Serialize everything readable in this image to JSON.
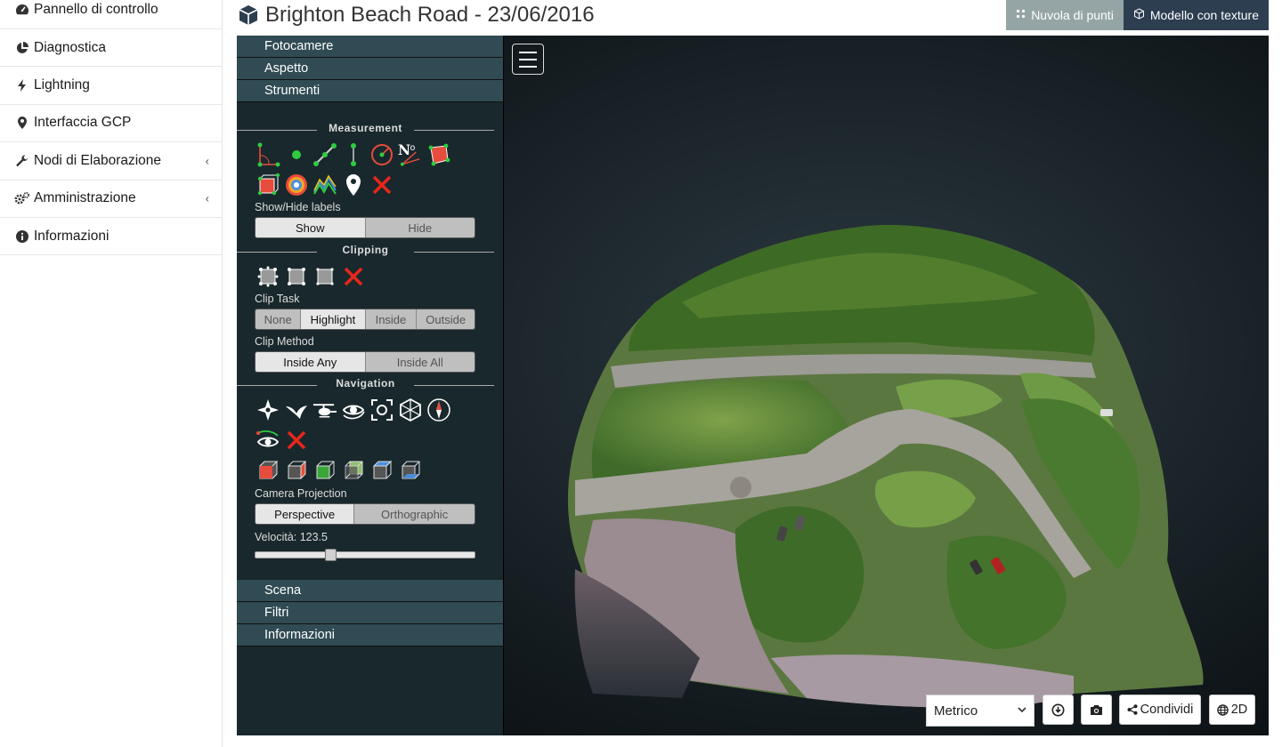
{
  "sidebar": {
    "items": [
      {
        "label": "Pannello di controllo",
        "icon": "dashboard-icon"
      },
      {
        "label": "Diagnostica",
        "icon": "pie-chart-icon"
      },
      {
        "label": "Lightning",
        "icon": "bolt-icon"
      },
      {
        "label": "Interfaccia GCP",
        "icon": "map-marker-icon"
      },
      {
        "label": "Nodi di Elaborazione",
        "icon": "wrench-icon",
        "arrow": "‹"
      },
      {
        "label": "Amministrazione",
        "icon": "cogs-icon",
        "arrow": "‹"
      },
      {
        "label": "Informazioni",
        "icon": "info-circle-icon"
      }
    ]
  },
  "header": {
    "title": "Brighton Beach Road - 23/06/2016",
    "view_toggle": {
      "point_cloud": "Nuvola di punti",
      "textured_model": "Modello con texture",
      "active": "textured_model"
    }
  },
  "panel": {
    "accordion_top": [
      "Fotocamere",
      "Aspetto",
      "Strumenti"
    ],
    "accordion_bottom": [
      "Scena",
      "Filtri",
      "Informazioni"
    ],
    "measurement": {
      "title": "Measurement",
      "labels_caption": "Show/Hide labels",
      "labels_options": [
        "Show",
        "Hide"
      ],
      "labels_selected": "Show"
    },
    "clipping": {
      "title": "Clipping",
      "task_caption": "Clip Task",
      "task_options": [
        "None",
        "Highlight",
        "Inside",
        "Outside"
      ],
      "task_selected": "Highlight",
      "method_caption": "Clip Method",
      "method_options": [
        "Inside Any",
        "Inside All"
      ],
      "method_selected": "Inside Any"
    },
    "navigation": {
      "title": "Navigation",
      "projection_caption": "Camera Projection",
      "projection_options": [
        "Perspective",
        "Orthographic"
      ],
      "projection_selected": "Perspective",
      "speed_label": "Velocità: 123.5",
      "speed_fraction": 0.33
    }
  },
  "bottom": {
    "units": "Metrico",
    "share": "Condividi",
    "two_d": "2D"
  },
  "colors": {
    "accent_dark": "#2c3e50",
    "accent_gray": "#95a5a6",
    "panel_bg": "#19282c",
    "accordion_bg": "#304b53"
  }
}
